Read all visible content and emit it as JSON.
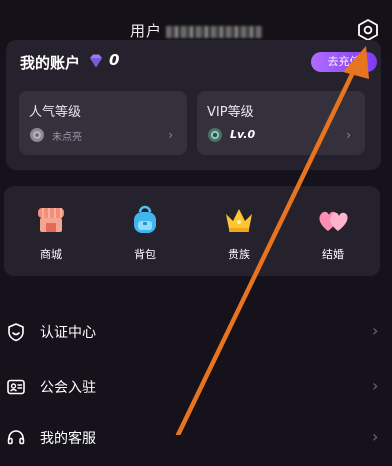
{
  "header": {
    "title": "用户",
    "settings_icon": "settings-hexagon-icon"
  },
  "account": {
    "title": "我的账户",
    "value": "0",
    "recharge_label": "去充值",
    "currency_icon": "purple-diamond-icon"
  },
  "levels": [
    {
      "label": "人气等级",
      "value": "未点亮",
      "icon": "grey-badge-icon"
    },
    {
      "label": "VIP等级",
      "value": "Lv.0",
      "icon": "teal-vip-badge-icon"
    }
  ],
  "features": [
    {
      "label": "商城",
      "icon": "shop-icon"
    },
    {
      "label": "背包",
      "icon": "backpack-icon"
    },
    {
      "label": "贵族",
      "icon": "crown-icon"
    },
    {
      "label": "结婚",
      "icon": "hearts-icon"
    }
  ],
  "menu": [
    {
      "label": "认证中心",
      "icon": "certification-shield-icon"
    },
    {
      "label": "公会入驻",
      "icon": "guild-card-icon"
    },
    {
      "label": "我的客服",
      "icon": "customer-service-icon"
    }
  ],
  "colors": {
    "background": "#15121b",
    "card": "#25212d",
    "sub_card": "#34303c",
    "accent_purple": "#9b59f5",
    "annotation_arrow": "#e8741f"
  }
}
